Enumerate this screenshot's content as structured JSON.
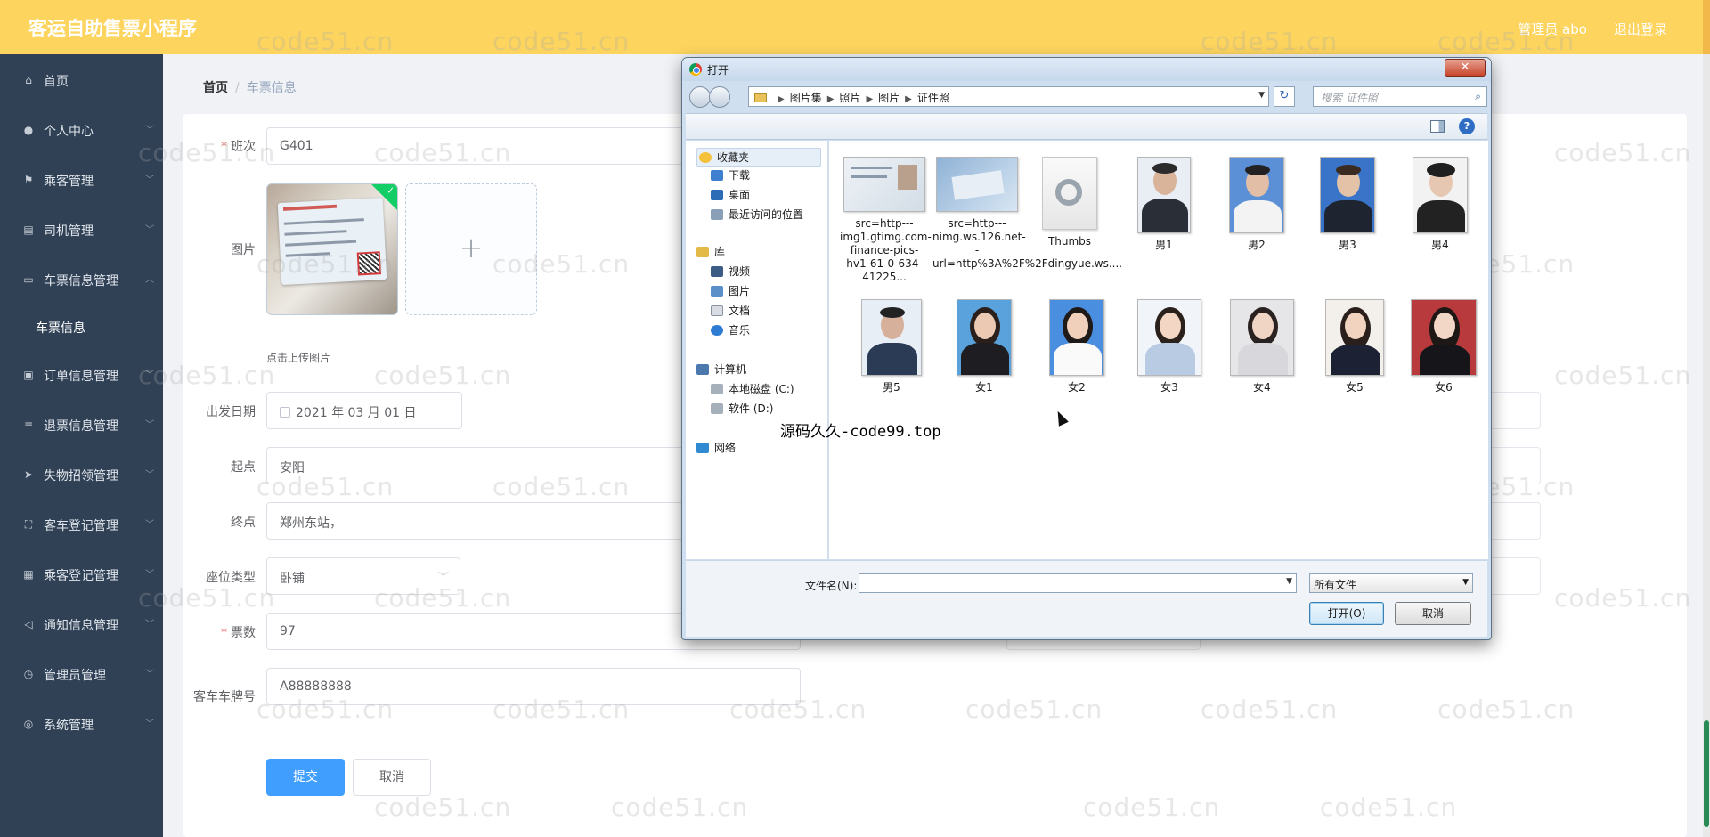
{
  "header": {
    "title": "客运自助售票小程序",
    "user": "管理员 abo",
    "logout": "退出登录"
  },
  "sidebar": {
    "items": [
      {
        "label": "首页",
        "icon": "home-icon",
        "glyph": "⌂",
        "chevron": false
      },
      {
        "label": "个人中心",
        "icon": "user-icon",
        "glyph": "●",
        "chevron": true
      },
      {
        "label": "乘客管理",
        "icon": "flag-icon",
        "glyph": "⚑",
        "chevron": true
      },
      {
        "label": "司机管理",
        "icon": "grid-icon",
        "glyph": "▤",
        "chevron": true
      },
      {
        "label": "车票信息管理",
        "icon": "chat-icon",
        "glyph": "▭",
        "chevron": true,
        "open": true
      },
      {
        "label": "订单信息管理",
        "icon": "clipboard-icon",
        "glyph": "▣",
        "chevron": true
      },
      {
        "label": "退票信息管理",
        "icon": "list-icon",
        "glyph": "≡",
        "chevron": true
      },
      {
        "label": "失物招领管理",
        "icon": "send-icon",
        "glyph": "➤",
        "chevron": true
      },
      {
        "label": "客车登记管理",
        "icon": "frame-icon",
        "glyph": "⛶",
        "chevron": true
      },
      {
        "label": "乘客登记管理",
        "icon": "apps-icon",
        "glyph": "▦",
        "chevron": true
      },
      {
        "label": "通知信息管理",
        "icon": "navigation-icon",
        "glyph": "◁",
        "chevron": true
      },
      {
        "label": "管理员管理",
        "icon": "clock-icon",
        "glyph": "◷",
        "chevron": true
      },
      {
        "label": "系统管理",
        "icon": "settings-icon",
        "glyph": "◎",
        "chevron": true
      }
    ],
    "sub_item": "车票信息"
  },
  "breadcrumb": {
    "home": "首页",
    "separator": "/",
    "current": "车票信息"
  },
  "form": {
    "banci": {
      "label": "班次",
      "value": "G401"
    },
    "image": {
      "label": "图片",
      "tip": "点击上传图片"
    },
    "date": {
      "label": "出发日期",
      "value": "2021 年 03 月 01 日"
    },
    "origin": {
      "label": "起点",
      "value": "安阳"
    },
    "destination": {
      "label": "终点",
      "value": "郑州东站，"
    },
    "seat": {
      "label": "座位类型",
      "value": "卧铺"
    },
    "count": {
      "label": "票数",
      "value": "97"
    },
    "plate": {
      "label": "客车车牌号",
      "value": "A88888888"
    },
    "submit": "提交",
    "cancel": "取消"
  },
  "watermark": "code51.cn",
  "dialog": {
    "title": "打开",
    "close": "✕",
    "path": [
      "图片集",
      "照片",
      "图片",
      "证件照"
    ],
    "search_placeholder": "搜索 证件照",
    "tree": {
      "favorites": "收藏夹",
      "downloads": "下载",
      "desktop": "桌面",
      "recent": "最近访问的位置",
      "libraries": "库",
      "videos": "视频",
      "pictures": "图片",
      "documents": "文档",
      "music": "音乐",
      "computer": "计算机",
      "disk_c": "本地磁盘 (C:)",
      "disk_d": "软件 (D:)",
      "network": "网络"
    },
    "files": [
      {
        "name": "src=http---img1.gtimg.com-finance-pics-hv1-61-0-634-41225...",
        "kind": "doc"
      },
      {
        "name": "src=http---nimg.ws.126.net--url=http%3A%2F%2Fdingyue.ws....",
        "kind": "doc"
      },
      {
        "name": "Thumbs",
        "kind": "system"
      },
      {
        "name": "男1",
        "kind": "photo"
      },
      {
        "name": "男2",
        "kind": "photo"
      },
      {
        "name": "男3",
        "kind": "photo"
      },
      {
        "name": "男4",
        "kind": "photo"
      },
      {
        "name": "男5",
        "kind": "photo"
      },
      {
        "name": "女1",
        "kind": "photo"
      },
      {
        "name": "女2",
        "kind": "photo"
      },
      {
        "name": "女3",
        "kind": "photo"
      },
      {
        "name": "女4",
        "kind": "photo"
      },
      {
        "name": "女5",
        "kind": "photo"
      },
      {
        "name": "女6",
        "kind": "photo"
      }
    ],
    "filename_label": "文件名(N):",
    "filename_value": "",
    "filetype": "所有文件",
    "open_button": "打开(O)",
    "cancel_button": "取消"
  },
  "overlay_text": "源码久久-code99.top",
  "colors": {
    "header": "#fcd45e",
    "sidebar": "#304156",
    "primary": "#409eff",
    "success": "#13ce66"
  }
}
